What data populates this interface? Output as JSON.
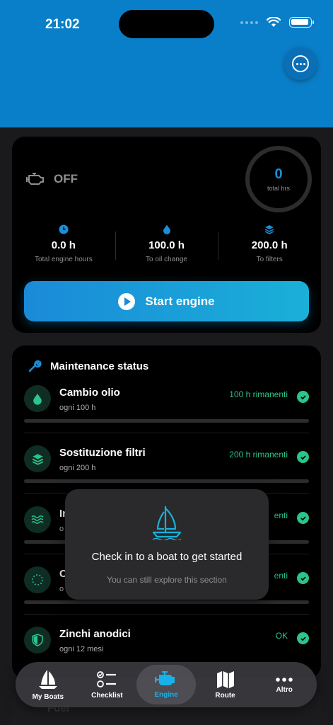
{
  "status_bar": {
    "time": "21:02"
  },
  "engine": {
    "state_label": "OFF",
    "gauge_value": "0",
    "gauge_label": "total hrs",
    "stats": [
      {
        "value": "0.0 h",
        "caption": "Total engine hours",
        "icon": "clock-icon"
      },
      {
        "value": "100.0 h",
        "caption": "To oil change",
        "icon": "drop-icon"
      },
      {
        "value": "200.0 h",
        "caption": "To filters",
        "icon": "layers-icon"
      }
    ],
    "start_label": "Start engine"
  },
  "maintenance": {
    "title": "Maintenance status",
    "items": [
      {
        "name": "Cambio olio",
        "interval": "ogni 100 h",
        "remaining": "100 h rimanenti",
        "icon": "drop-icon"
      },
      {
        "name": "Sostituzione filtri",
        "interval": "ogni 200 h",
        "remaining": "200 h rimanenti",
        "icon": "layers-icon"
      },
      {
        "name": "Im",
        "interval": "o",
        "remaining": "enti",
        "icon": "waves-icon"
      },
      {
        "name": "C",
        "interval": "o",
        "remaining": "enti",
        "icon": "circle-dashed-icon"
      },
      {
        "name": "Zinchi anodici",
        "interval": "ogni 12 mesi",
        "remaining": "OK",
        "icon": "shield-icon"
      }
    ]
  },
  "fuel": {
    "label": "Fuel"
  },
  "toast": {
    "title": "Check in to a boat to get started",
    "subtitle": "You can still explore this section"
  },
  "tabs": [
    {
      "label": "My Boats",
      "icon": "sailboat-icon"
    },
    {
      "label": "Checklist",
      "icon": "checklist-icon"
    },
    {
      "label": "Engine",
      "icon": "engine-icon",
      "active": true
    },
    {
      "label": "Route",
      "icon": "map-icon"
    },
    {
      "label": "Altro",
      "icon": "more-icon"
    }
  ],
  "colors": {
    "header": "#0a7fc9",
    "accent": "#1a8fd8",
    "ok_green": "#2bc48a",
    "active_tab": "#1ab0e8"
  }
}
